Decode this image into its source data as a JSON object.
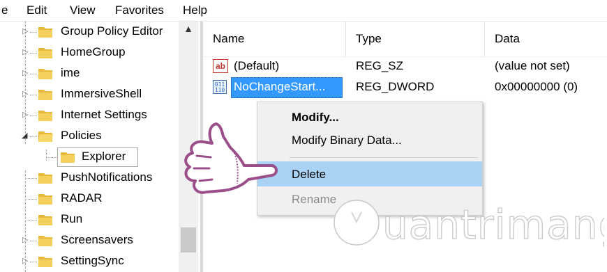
{
  "menubar": {
    "items": [
      "e",
      "Edit",
      "View",
      "Favorites",
      "Help"
    ]
  },
  "tree": {
    "items": [
      {
        "label": "Group Policy Editor",
        "expander": "▷"
      },
      {
        "label": "HomeGroup",
        "expander": "▷"
      },
      {
        "label": "ime",
        "expander": "▷"
      },
      {
        "label": "ImmersiveShell",
        "expander": "▷"
      },
      {
        "label": "Internet Settings",
        "expander": "▷"
      },
      {
        "label": "Policies",
        "expander": "◢"
      },
      {
        "label": "Explorer",
        "expander": ""
      },
      {
        "label": "PushNotifications",
        "expander": ""
      },
      {
        "label": "RADAR",
        "expander": ""
      },
      {
        "label": "Run",
        "expander": ""
      },
      {
        "label": "Screensavers",
        "expander": "▷"
      },
      {
        "label": "SettingSync",
        "expander": "▷"
      }
    ],
    "scroll_up": "▲"
  },
  "list": {
    "columns": [
      "Name",
      "Type",
      "Data"
    ],
    "rows": [
      {
        "icon": "ab",
        "name": "(Default)",
        "type": "REG_SZ",
        "data": "(value not set)"
      },
      {
        "icon": "binary",
        "name": "NoChangeStart...",
        "type": "REG_DWORD",
        "data": "0x00000000 (0)"
      }
    ]
  },
  "context_menu": {
    "items": [
      "Modify...",
      "Modify Binary Data...",
      "Delete",
      "Rename"
    ],
    "highlighted": "Delete",
    "disabled": "Rename"
  },
  "colors": {
    "selection": "#3399ff",
    "menu_hover": "#a9d2f5",
    "folder": "#e8b83a",
    "hand": "#9a4e8a"
  },
  "watermark": {
    "text": "uantrimang"
  }
}
